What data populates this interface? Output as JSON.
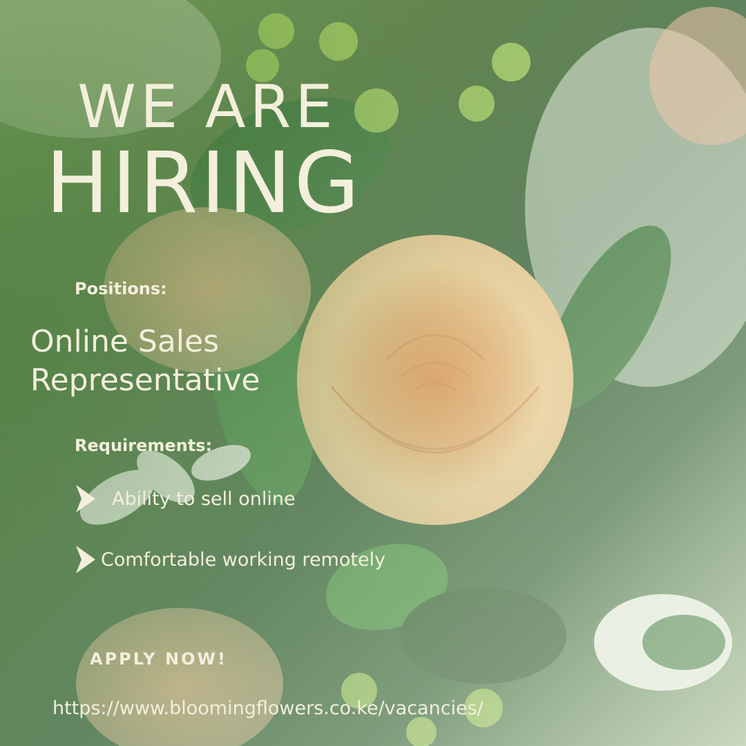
{
  "poster": {
    "headline_top": "WE ARE",
    "headline_main": "HIRING",
    "positions_label": "Positions:",
    "position_lines": [
      "Online Sales",
      "Representative"
    ],
    "requirements_label": "Requirements:",
    "requirements": [
      "Ability to sell online",
      "Comfortable working remotely"
    ],
    "cta": "APPLY NOW!",
    "url": "https://www.bloomingflowers.co.ke/vacancies/"
  },
  "colors": {
    "text": "#f3efdc",
    "rose": "#f2b06a",
    "leaf": "#2f6a2c",
    "background_dark": "#1f4d21"
  },
  "icons": [
    "arrow-right-icon"
  ]
}
